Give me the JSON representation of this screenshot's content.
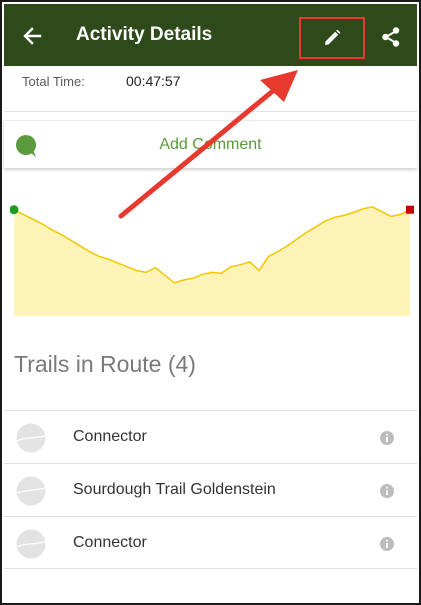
{
  "appbar": {
    "title": "Activity Details",
    "back_icon": "arrow-left-icon",
    "edit_icon": "pencil-icon",
    "share_icon": "share-icon",
    "background_color": "#2e4a1a"
  },
  "summary": {
    "total_time_label": "Total Time:",
    "total_time_value": "00:47:57"
  },
  "comment": {
    "label": "Add Comment",
    "icon": "speech-bubble-icon",
    "accent_color": "#5a9a3c"
  },
  "elevation_profile": {
    "fill_color": "#fff3b8",
    "line_color": "#f2c800",
    "start_marker_color": "#1e9a1e",
    "end_marker_color": "#c40000",
    "profile": [
      0.94,
      0.89,
      0.84,
      0.79,
      0.73,
      0.68,
      0.62,
      0.56,
      0.5,
      0.45,
      0.42,
      0.38,
      0.34,
      0.3,
      0.28,
      0.33,
      0.25,
      0.17,
      0.2,
      0.22,
      0.26,
      0.28,
      0.27,
      0.34,
      0.36,
      0.39,
      0.3,
      0.45,
      0.5,
      0.56,
      0.63,
      0.7,
      0.76,
      0.82,
      0.86,
      0.88,
      0.91,
      0.95,
      0.97,
      0.92,
      0.87,
      0.89,
      0.94
    ]
  },
  "trails_section": {
    "title": "Trails in Route (4)",
    "items": [
      {
        "name": "Connector",
        "thumb_icon": "trail-map-icon",
        "info_icon": "info-icon"
      },
      {
        "name": "Sourdough Trail Goldenstein",
        "thumb_icon": "trail-map-icon",
        "info_icon": "info-icon"
      },
      {
        "name": "Connector",
        "thumb_icon": "trail-map-icon",
        "info_icon": "info-icon"
      }
    ]
  },
  "annotation": {
    "highlight_color": "#e8392e"
  }
}
